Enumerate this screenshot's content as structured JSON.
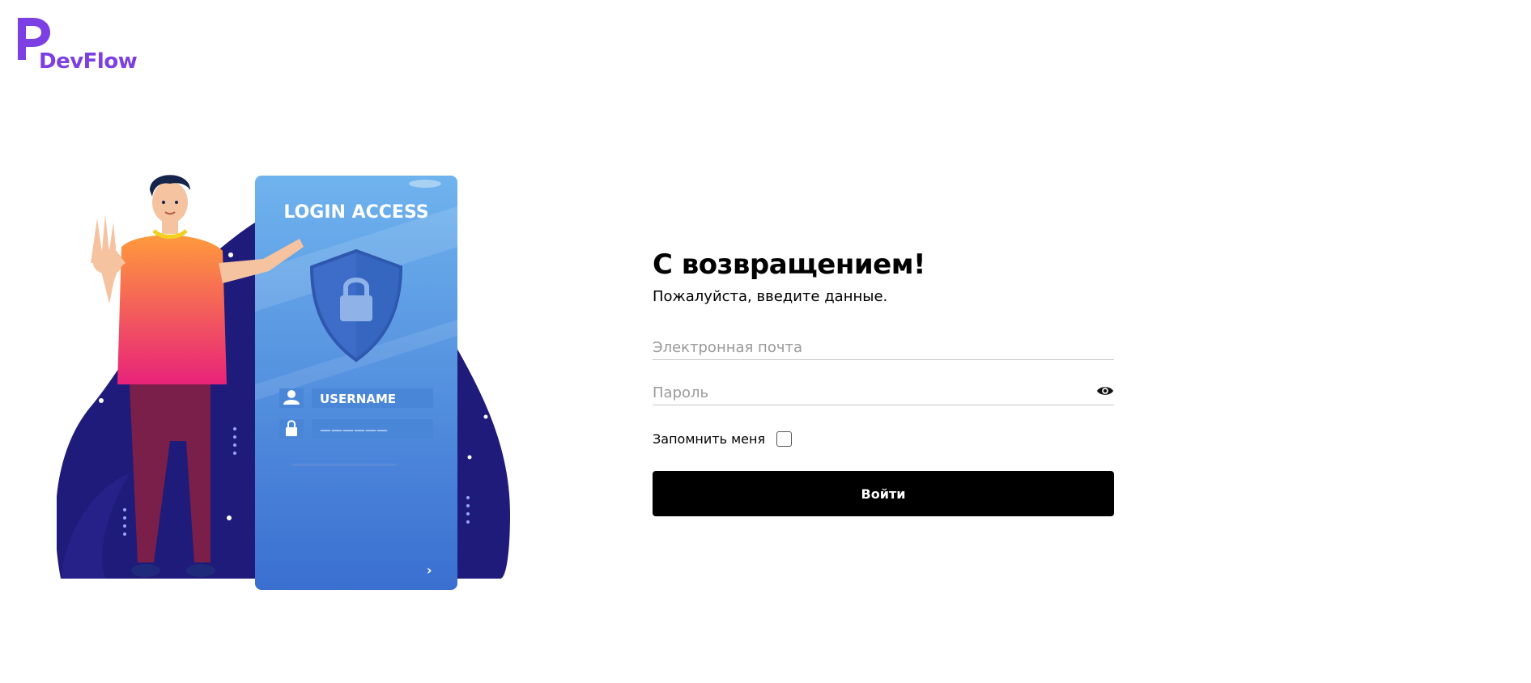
{
  "brand": {
    "name": "DevFlow",
    "color": "#7b3fe4"
  },
  "illustration": {
    "card_title": "LOGIN ACCESS",
    "username_label": "USERNAME",
    "password_mask": "——————"
  },
  "form": {
    "title": "С возвращением!",
    "subtitle": "Пожалуйста, введите данные.",
    "email_placeholder": "Электронная почта",
    "email_value": "",
    "password_placeholder": "Пароль",
    "password_value": "",
    "password_toggle_icon": "eye-icon",
    "remember_label": "Запомнить меня",
    "remember_checked": false,
    "submit_label": "Войти"
  }
}
